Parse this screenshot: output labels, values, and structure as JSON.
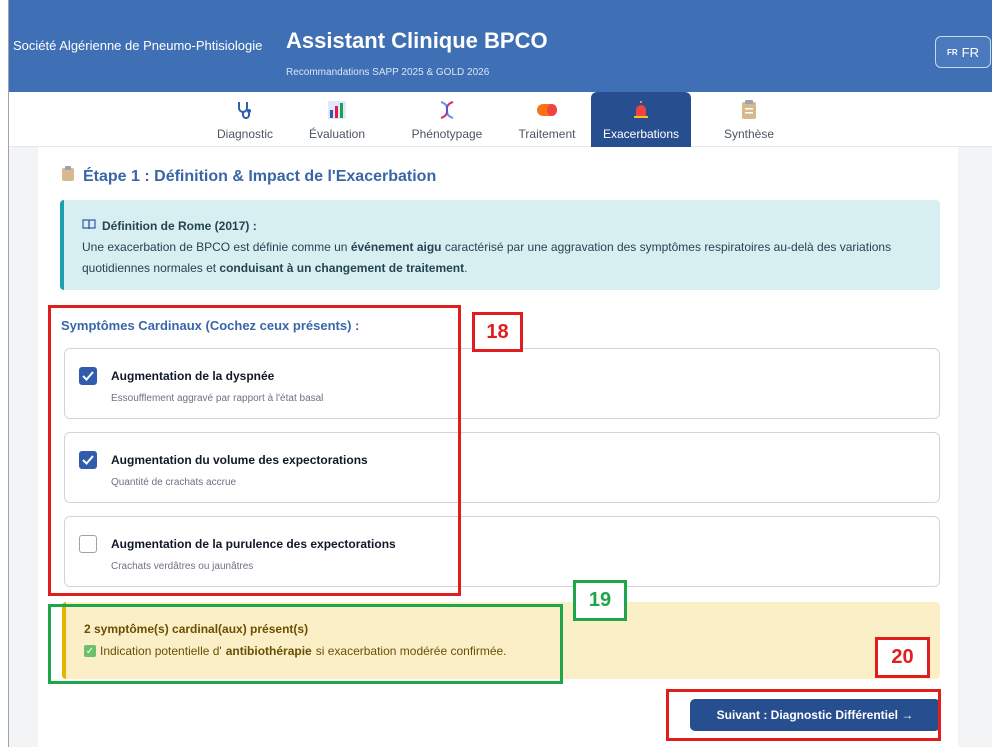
{
  "header": {
    "org": "Société Algérienne de Pneumo-Phtisiologie",
    "title": "Assistant Clinique BPCO",
    "subtitle": "Recommandations SAPP 2025 & GOLD 2026",
    "lang_flag": "FR",
    "lang_label": "FR"
  },
  "tabs": [
    {
      "label": "Diagnostic",
      "icon": "stethoscope-icon"
    },
    {
      "label": "Évaluation",
      "icon": "bar-chart-icon"
    },
    {
      "label": "Phénotypage",
      "icon": "dna-icon"
    },
    {
      "label": "Traitement",
      "icon": "pill-icon"
    },
    {
      "label": "Exacerbations",
      "icon": "siren-icon",
      "active": true
    },
    {
      "label": "Synthèse",
      "icon": "clipboard-icon"
    }
  ],
  "step": {
    "title": "Étape 1 : Définition & Impact de l'Exacerbation"
  },
  "definition": {
    "heading": "Définition de Rome (2017) :",
    "text_1": "Une exacerbation de BPCO est définie comme un ",
    "bold_1": "événement aigu",
    "text_2": " caractérisé par une aggravation des symptômes respiratoires au-delà des variations quotidiennes normales et ",
    "bold_2": "conduisant à un changement de traitement",
    "text_3": "."
  },
  "symptoms": {
    "heading": "Symptômes Cardinaux (Cochez ceux présents) :",
    "items": [
      {
        "title": "Augmentation de la dyspnée",
        "desc": "Essoufflement aggravé par rapport à l'état basal",
        "checked": true
      },
      {
        "title": "Augmentation du volume des expectorations",
        "desc": "Quantité de crachats accrue",
        "checked": true
      },
      {
        "title": "Augmentation de la purulence des expectorations",
        "desc": "Crachats verdâtres ou jaunâtres",
        "checked": false
      }
    ]
  },
  "alert": {
    "heading": "2 symptôme(s) cardinal(aux) présent(s)",
    "text_1": "Indication potentielle d'",
    "bold": "antibiothérapie",
    "text_2": " si exacerbation modérée confirmée."
  },
  "next_button": "Suivant : Diagnostic Différentiel →",
  "annotations": {
    "a18": "18",
    "a19": "19",
    "a20": "20"
  },
  "colors": {
    "header": "#3f6fb4",
    "accent": "#274f8f",
    "info_bg": "#d8eff1",
    "alert_bg": "#fbefc8"
  }
}
